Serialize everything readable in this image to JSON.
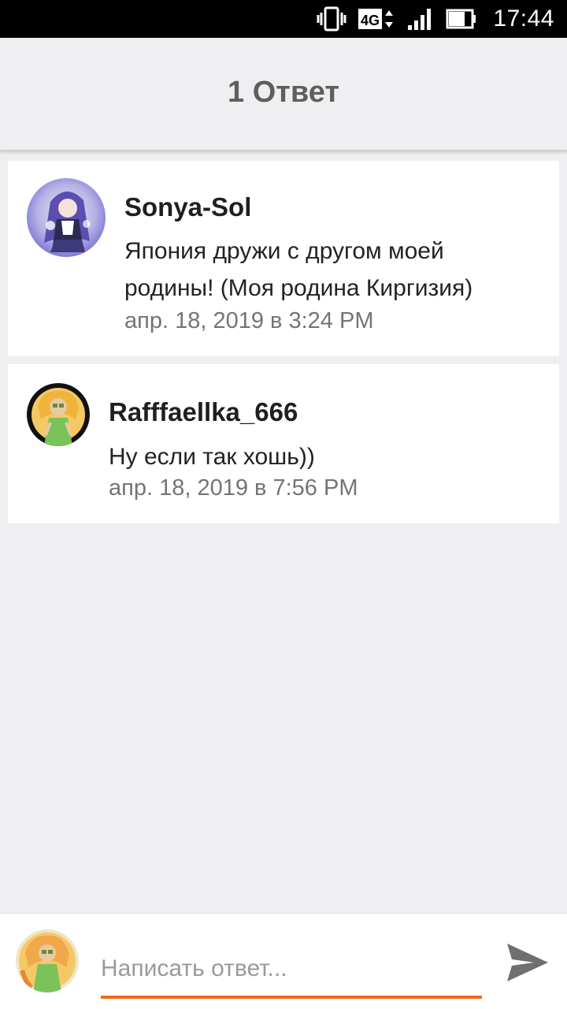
{
  "status_bar": {
    "time": "17:44",
    "network": "4G",
    "icons": [
      "vibrate-icon",
      "network-4g-icon",
      "signal-icon",
      "battery-icon"
    ]
  },
  "header": {
    "title": "1 Ответ"
  },
  "comments": [
    {
      "username": "Sonya-Sol",
      "text_lines": [
        "Япония дружи с другом моей",
        "родины! (Моя родина Киргизия)"
      ],
      "timestamp": "апр. 18, 2019 в 3:24 PM",
      "avatar": "anime-girl-avatar"
    },
    {
      "username": "Rafffaellka_666",
      "text_lines": [
        "Ну если так хошь))"
      ],
      "timestamp": "апр. 18, 2019 в 7:56 PM",
      "avatar": "drawn-character-avatar"
    }
  ],
  "reply": {
    "placeholder": "Написать ответ...",
    "value": "",
    "send_icon": "send-icon"
  },
  "colors": {
    "accent": "#f26a1b",
    "background": "#efeef1",
    "status_bar": "#000000",
    "timestamp": "#747474",
    "header_title": "#5e5e5e"
  }
}
